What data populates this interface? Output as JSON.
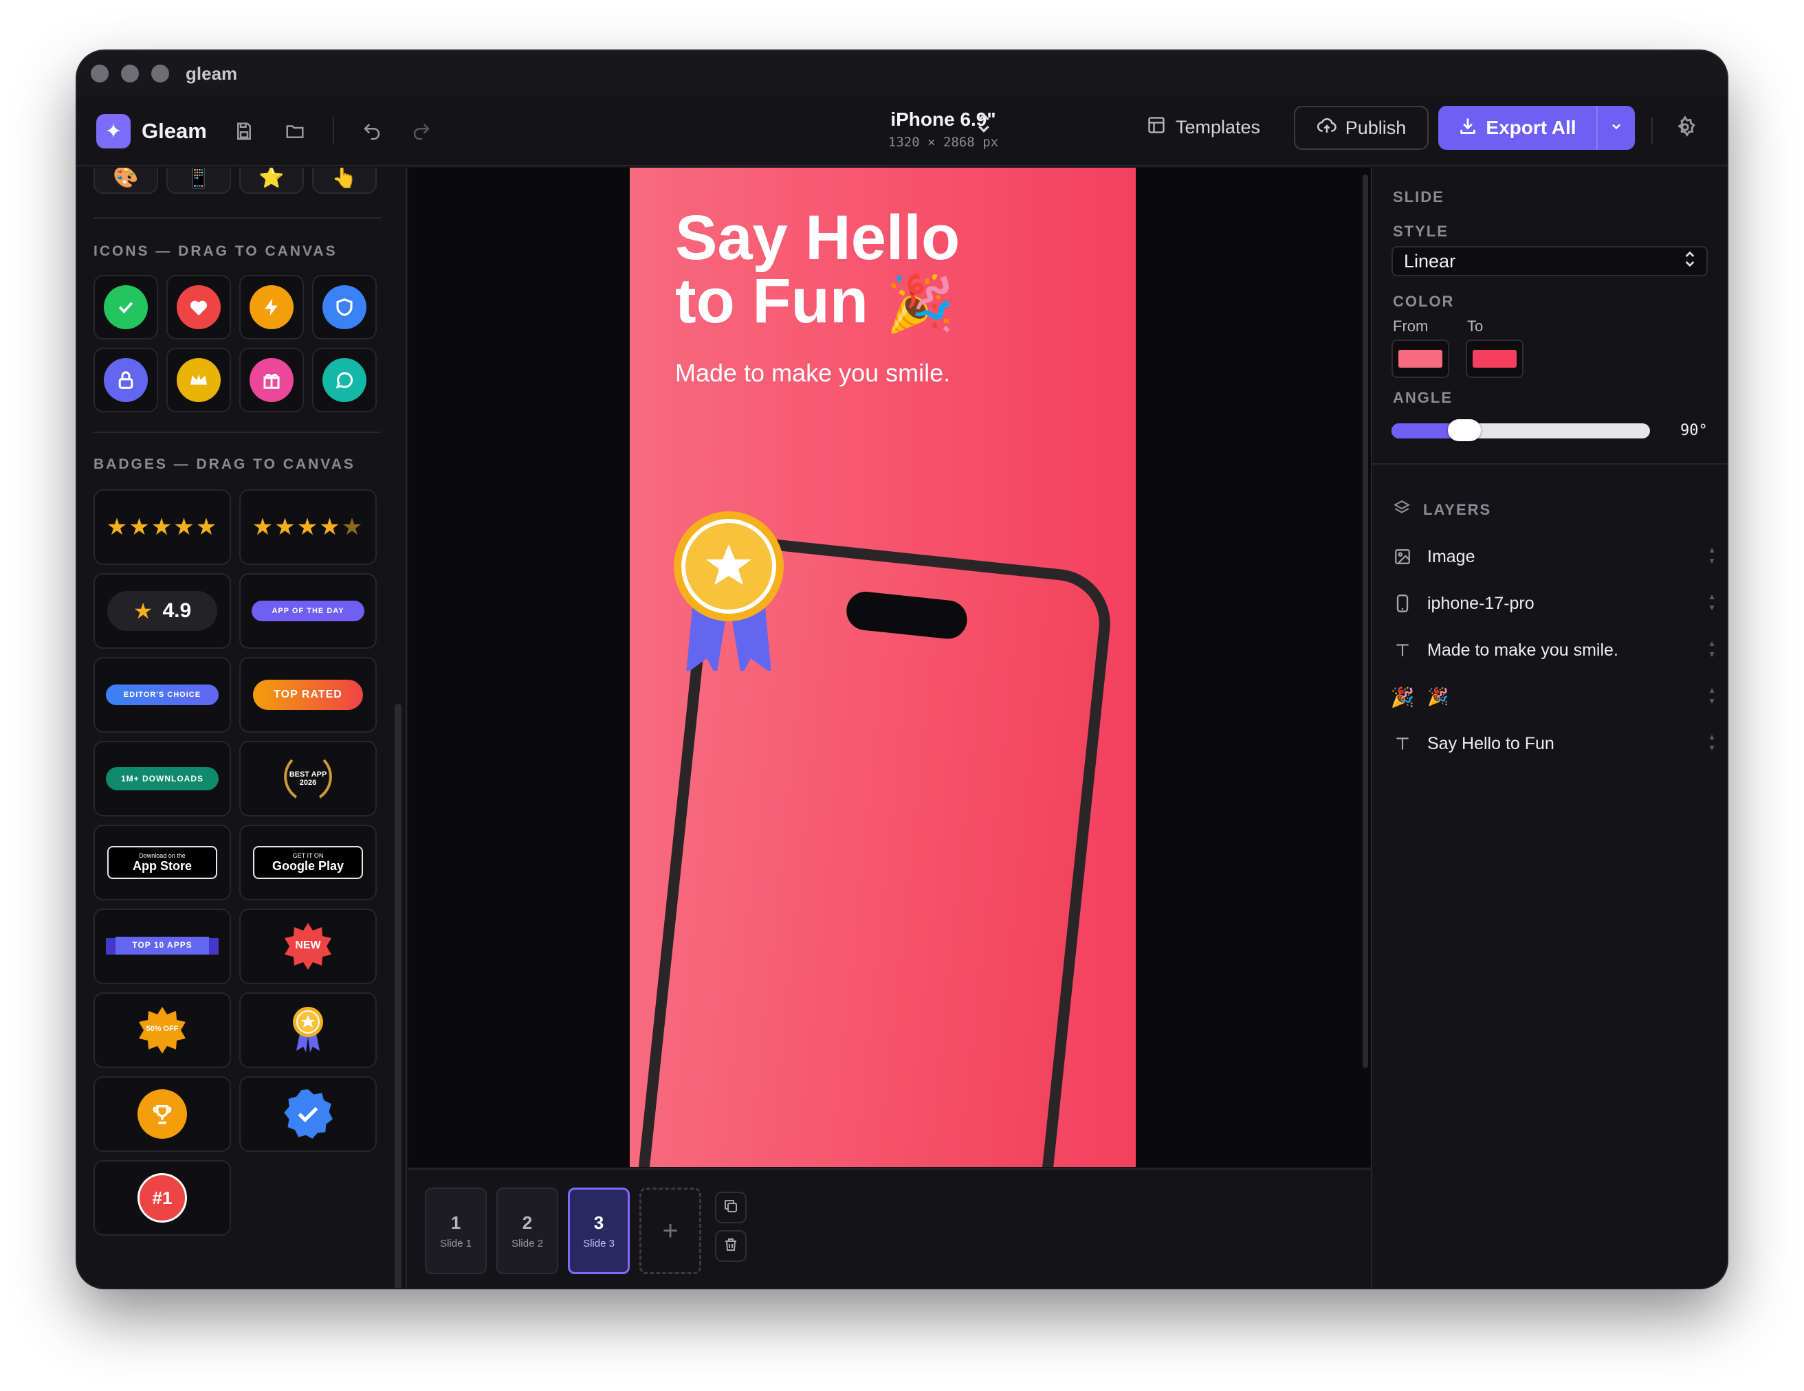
{
  "window": {
    "title": "gleam"
  },
  "toolbar": {
    "brand": "Gleam",
    "device_name": "iPhone 6.9\"",
    "device_size": "1320 × 2868 px",
    "templates_label": "Templates",
    "publish_label": "Publish",
    "export_label": "Export All"
  },
  "sidebar": {
    "emoji_row": [
      "🎨",
      "📱",
      "⭐",
      "👆"
    ],
    "icons_label": "ICONS — DRAG TO CANVAS",
    "badges_label": "BADGES — DRAG TO CANVAS",
    "badges": {
      "rating_value": "4.9",
      "app_of_day": "APP OF THE DAY",
      "editors_choice": "EDITOR'S CHOICE",
      "top_rated": "TOP RATED",
      "downloads": "1M+ DOWNLOADS",
      "best_app_line1": "BEST APP",
      "best_app_line2": "2026",
      "appstore_small": "Download on the",
      "appstore_big": "App Store",
      "googleplay_small": "GET IT ON",
      "googleplay_big": "Google Play",
      "top10": "TOP 10 APPS",
      "new": "NEW",
      "off": "50% OFF",
      "rank": "#1"
    }
  },
  "slide": {
    "title_line1": "Say Hello",
    "title_line2": "to Fun",
    "title_emoji": "🎉",
    "subtitle": "Made to make you smile.",
    "gradient_from": "#f96a7e",
    "gradient_to": "#f4405e"
  },
  "filmstrip": {
    "slides": [
      {
        "num": "1",
        "label": "Slide 1"
      },
      {
        "num": "2",
        "label": "Slide 2"
      },
      {
        "num": "3",
        "label": "Slide 3"
      }
    ],
    "active_index": 2
  },
  "inspector": {
    "slide_label": "SLIDE",
    "style_label": "STYLE",
    "style_value": "Linear",
    "color_label": "COLOR",
    "from_label": "From",
    "to_label": "To",
    "from_color": "#f96a7e",
    "to_color": "#f4405e",
    "angle_label": "ANGLE",
    "angle_value": "90°",
    "angle_fraction": 0.25,
    "layers_label": "LAYERS",
    "layers": [
      {
        "icon": "image-icon",
        "name": "Image"
      },
      {
        "icon": "phone-icon",
        "name": "iphone-17-pro"
      },
      {
        "icon": "text-icon",
        "name": "Made to make you smile."
      },
      {
        "icon": "party-emoji",
        "name": "🎉"
      },
      {
        "icon": "text-icon",
        "name": "Say Hello to Fun"
      }
    ]
  },
  "colors": {
    "accent": "#6f5ff5",
    "green": "#22c55e",
    "red": "#ef4444",
    "orange": "#f59e0b",
    "blue": "#3b82f6",
    "indigo": "#6366f1",
    "yellow": "#eab308",
    "pink": "#ec4899",
    "teal": "#14b8a6"
  }
}
